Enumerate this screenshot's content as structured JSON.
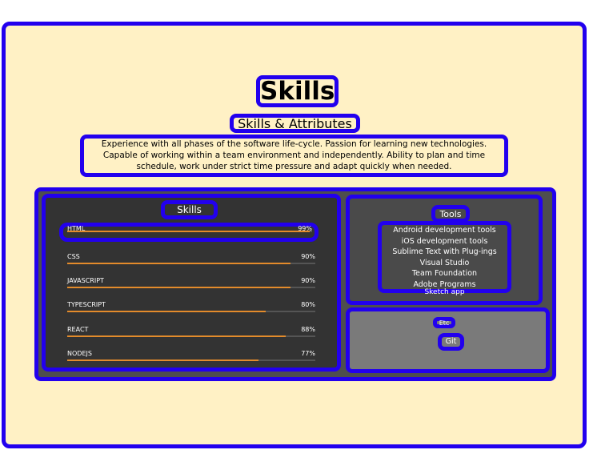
{
  "page": {
    "title": "Skills",
    "subtitle": "Skills & Attributes",
    "intro": "Experience with all phases of the software life-cycle. Passion for learning new technologies. Capable of working within a team environment and independently. Ability to plan and time schedule, work under strict time pressure and adapt quickly when needed."
  },
  "skills": {
    "heading": "Skills",
    "items": [
      {
        "name": "HTML",
        "percent_label": "99%",
        "level": 0.99
      },
      {
        "name": "CSS",
        "percent_label": "90%",
        "level": 0.9
      },
      {
        "name": "JAVASCRIPT",
        "percent_label": "90%",
        "level": 0.9
      },
      {
        "name": "TYPESCRIPT",
        "percent_label": "80%",
        "level": 0.8
      },
      {
        "name": "REACT",
        "percent_label": "88%",
        "level": 0.88
      },
      {
        "name": "NODEJS",
        "percent_label": "77%",
        "level": 0.77
      }
    ]
  },
  "tools": {
    "heading": "Tools",
    "items": [
      "Android development tools",
      "iOS development tools",
      "Sublime Text with Plug-ings",
      "Visual Studio",
      "Team Foundation",
      "Adobe Programs",
      "Sketch app"
    ]
  },
  "etc": {
    "heading": "Etc",
    "items": [
      "Git"
    ]
  },
  "colors": {
    "outline": "#2200ee",
    "page_background": "#fff1c5",
    "skills_panel": "#333333",
    "bar_fill": "#e38b2b"
  }
}
